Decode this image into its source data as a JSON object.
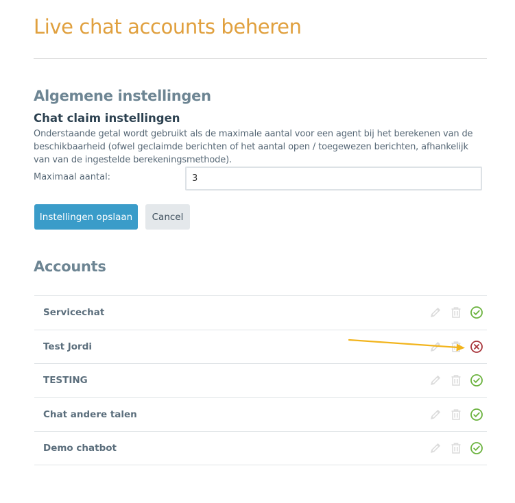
{
  "page": {
    "title": "Live chat accounts beheren"
  },
  "general": {
    "heading": "Algemene instellingen",
    "subheading": "Chat claim instellingen",
    "description": "Onderstaande getal wordt gebruikt als de maximale aantal voor een agent bij het berekenen van de beschikbaarheid (ofwel geclaimde berichten of het aantal open / toegewezen berichten, afhankelijk van van de ingestelde berekeningsmethode).",
    "max_label": "Maximaal aantal:",
    "max_value": "3",
    "save_label": "Instellingen opslaan",
    "cancel_label": "Cancel"
  },
  "accounts": {
    "heading": "Accounts",
    "items": [
      {
        "name": "Servicechat",
        "status": "active"
      },
      {
        "name": "Test Jordi",
        "status": "inactive"
      },
      {
        "name": "TESTING",
        "status": "active"
      },
      {
        "name": "Chat andere talen",
        "status": "active"
      },
      {
        "name": "Demo chatbot",
        "status": "active"
      }
    ],
    "icons": [
      "pencil-icon",
      "trash-icon",
      "check-circle-icon",
      "x-circle-icon"
    ]
  },
  "colors": {
    "title": "#e0a03e",
    "primary_button": "#3a9cc9",
    "active_status": "#6ab23d",
    "inactive_status": "#a8353b",
    "annotation_arrow": "#f2b41c"
  }
}
